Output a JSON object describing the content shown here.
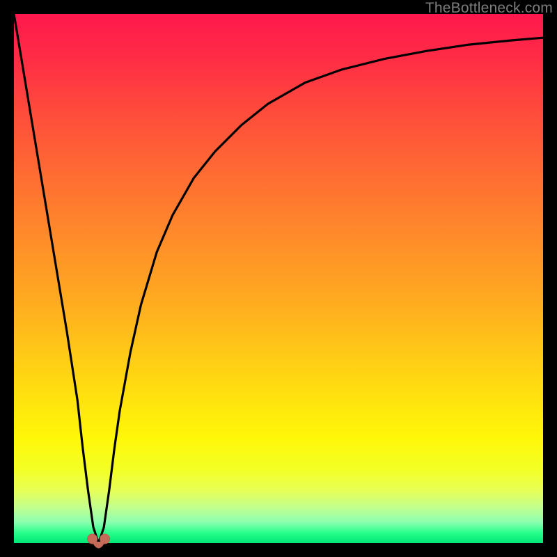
{
  "watermark": "TheBottleneck.com",
  "chart_data": {
    "type": "line",
    "title": "",
    "xlabel": "",
    "ylabel": "",
    "xlim": [
      0,
      100
    ],
    "ylim": [
      0,
      100
    ],
    "curve": {
      "description": "Bottleneck curve (percentage vs component performance). Sharp V at optimum then asymptotic rise to the right.",
      "x": [
        0,
        2,
        4,
        6,
        8,
        10,
        12,
        13,
        14,
        15,
        16,
        17,
        18,
        19,
        20,
        22,
        24,
        27,
        30,
        34,
        38,
        43,
        48,
        55,
        62,
        70,
        78,
        86,
        94,
        100
      ],
      "y": [
        100,
        88,
        76,
        64,
        52,
        40,
        27,
        18,
        10,
        3,
        0,
        3,
        10,
        18,
        25,
        36,
        45,
        55,
        62,
        69,
        74,
        79,
        83,
        87,
        89.5,
        91.5,
        93,
        94.2,
        95,
        95.5
      ]
    },
    "optimum_marker": {
      "x": 16,
      "y": 0
    },
    "background_gradient": {
      "orientation": "vertical",
      "stops": [
        {
          "t": 0.0,
          "color": "#ff184d"
        },
        {
          "t": 0.5,
          "color": "#ffaa20"
        },
        {
          "t": 0.8,
          "color": "#fff708"
        },
        {
          "t": 0.96,
          "color": "#8effb0"
        },
        {
          "t": 1.0,
          "color": "#00e676"
        }
      ]
    }
  }
}
